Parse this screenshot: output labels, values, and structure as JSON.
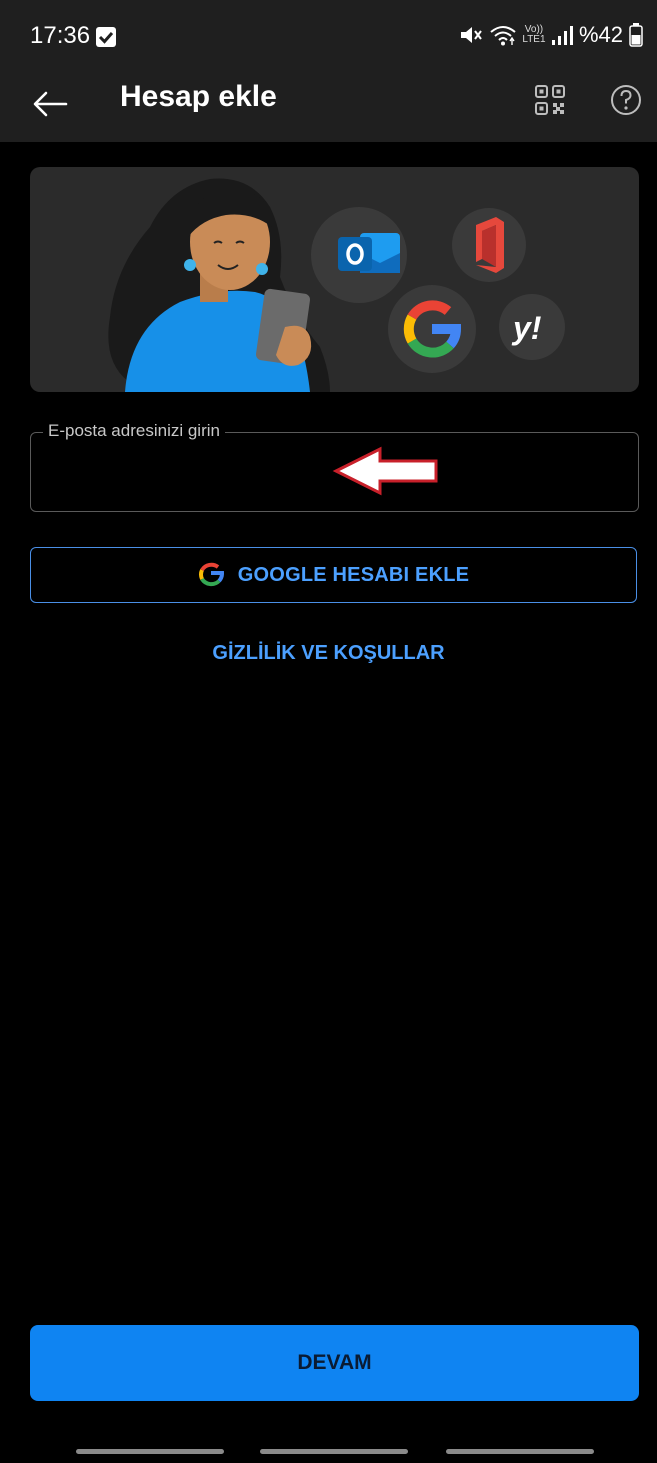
{
  "status_bar": {
    "time": "17:36",
    "battery_text": "%42",
    "network_label_top": "Vo))",
    "network_label_bottom": "LTE1"
  },
  "app_bar": {
    "title": "Hesap ekle"
  },
  "email_field": {
    "label": "E-posta adresinizi girin",
    "value": "",
    "placeholder": ""
  },
  "google_button": {
    "label": "GOOGLE HESABI EKLE"
  },
  "privacy_link": {
    "label": "GİZLİLİK VE KOŞULLAR"
  },
  "continue_button": {
    "label": "DEVAM"
  },
  "colors": {
    "accent": "#4ca0ff",
    "primary_button": "#0f84f2",
    "app_bar": "#1f1f1f",
    "background": "#000000"
  },
  "icons": [
    "checkbox-icon",
    "mute-icon",
    "wifi-icon",
    "signal-icon",
    "battery-icon",
    "back-arrow-icon",
    "qr-code-icon",
    "help-icon",
    "outlook-icon",
    "office-icon",
    "google-icon",
    "yahoo-icon"
  ]
}
